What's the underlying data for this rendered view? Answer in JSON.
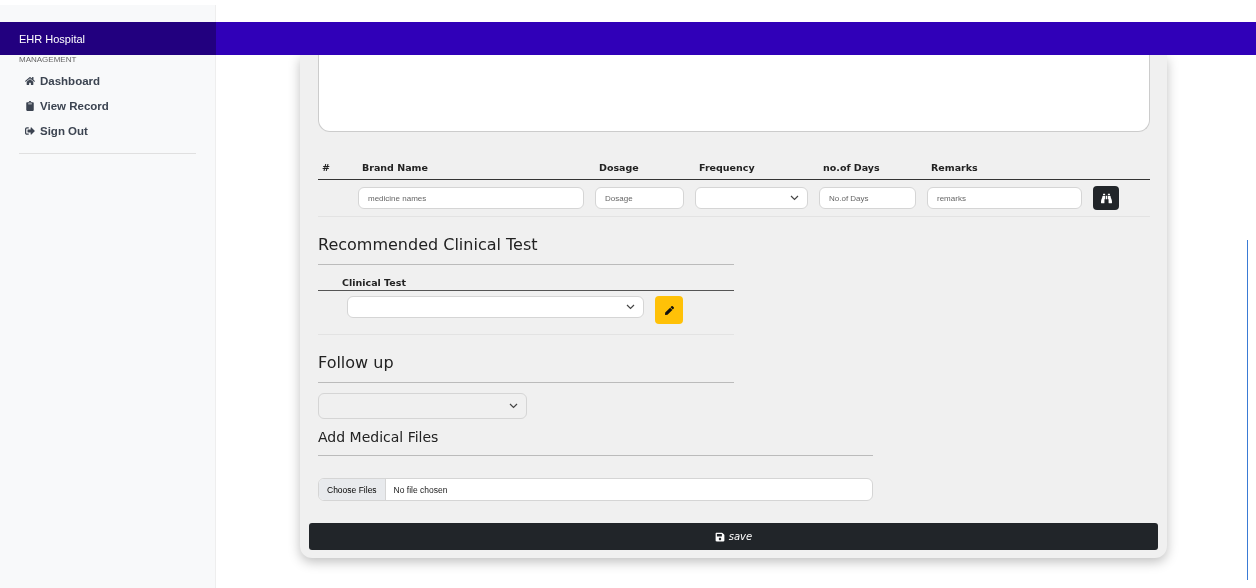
{
  "brand": "EHR Hospital",
  "sidebar": {
    "heading": "MANAGEMENT",
    "items": [
      {
        "label": "Dashboard"
      },
      {
        "label": "View Record"
      },
      {
        "label": "Sign Out"
      }
    ]
  },
  "prescription": {
    "columns": [
      "#",
      "Brand Name",
      "Dosage",
      "Frequency",
      "no.of Days",
      "Remarks"
    ],
    "row": {
      "brand_placeholder": "medicine names",
      "dosage_placeholder": "Dosage",
      "days_placeholder": "No.of Days",
      "remarks_placeholder": "remarks"
    }
  },
  "clinical": {
    "title": "Recommended Clinical Test",
    "column": "Clinical Test"
  },
  "followup": {
    "title": "Follow up"
  },
  "files": {
    "title": "Add Medical Files",
    "button": "Choose Files",
    "status": "No file chosen"
  },
  "save": "save"
}
